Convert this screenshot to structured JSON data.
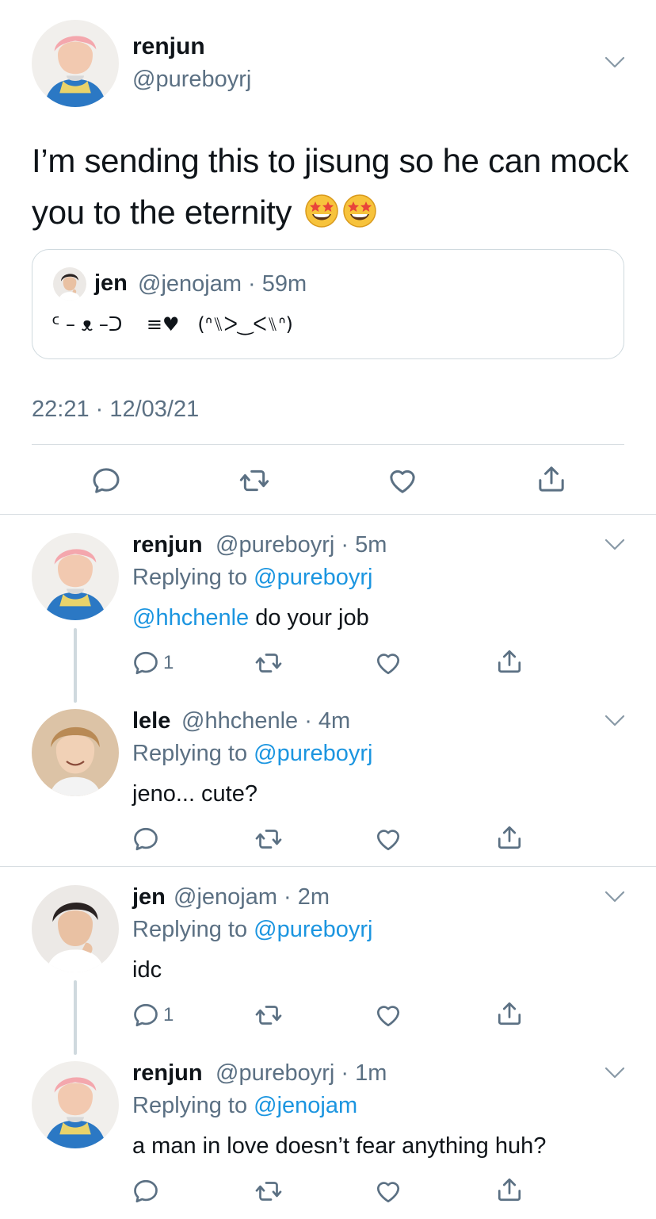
{
  "main": {
    "name": "renjun",
    "handle": "@pureboyrj",
    "text": "I’m sending this to jisung so he can mock you to the eternity",
    "emoji": "star-struck-emoji",
    "quote": {
      "name": "jen",
      "handle": "@jenojam · 59m",
      "text": "ᑦ – ᴥ –ᑐ    ≡♥   (ᐢ⑊ᐳ‿ᐸ⑊ᐢ)"
    },
    "timestamp": "22:21 · 12/03/21"
  },
  "replies": [
    {
      "name": "renjun",
      "meta": "@pureboyrj · 5m",
      "replying_prefix": "Replying to ",
      "replying_to": "@pureboyrj",
      "mention": "@hhchenle",
      "body": " do your job",
      "reply_count": "1"
    },
    {
      "name": "lele",
      "meta": "@hhchenle · 4m",
      "replying_prefix": "Replying to ",
      "replying_to": "@pureboyrj",
      "body": "jeno... cute?",
      "reply_count": ""
    },
    {
      "name": "jen",
      "meta": "@jenojam · 2m",
      "replying_prefix": "Replying to ",
      "replying_to": "@pureboyrj",
      "body": "idc",
      "reply_count": "1"
    },
    {
      "name": "renjun",
      "meta": "@pureboyrj · 1m",
      "replying_prefix": "Replying to ",
      "replying_to": "@jenojam",
      "body": "a man in love doesn’t fear anything huh?",
      "reply_count": ""
    }
  ],
  "colors": {
    "text": "#0f1419",
    "secondary": "#5b7083",
    "link": "#1b95e0",
    "border": "#cfd9de"
  }
}
